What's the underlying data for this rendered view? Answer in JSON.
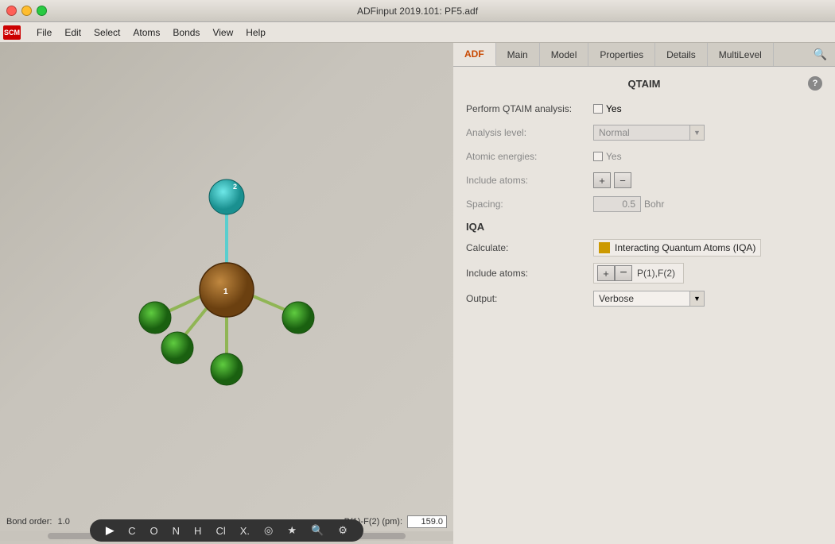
{
  "window": {
    "title": "ADFinput 2019.101: PF5.adf"
  },
  "titlebar_buttons": {
    "close": "close",
    "minimize": "minimize",
    "maximize": "maximize"
  },
  "menubar": {
    "logo": "SCM",
    "items": [
      "File",
      "Edit",
      "Select",
      "Atoms",
      "Bonds",
      "View",
      "Help"
    ]
  },
  "tabs": {
    "items": [
      "ADF",
      "Main",
      "Model",
      "Properties",
      "Details",
      "MultiLevel"
    ],
    "active": "ADF"
  },
  "section": {
    "title": "QTAIM",
    "help": "?"
  },
  "qtaim": {
    "perform_label": "Perform QTAIM analysis:",
    "perform_checked": false,
    "perform_yes": "Yes",
    "analysis_level_label": "Analysis level:",
    "analysis_level_value": "Normal",
    "atomic_energies_label": "Atomic energies:",
    "atomic_energies_checked": false,
    "atomic_energies_yes": "Yes",
    "include_atoms_label": "Include atoms:",
    "btn_plus": "+",
    "btn_minus": "−",
    "spacing_label": "Spacing:",
    "spacing_value": "0.5",
    "spacing_unit": "Bohr"
  },
  "iqa": {
    "section_title": "IQA",
    "calculate_label": "Calculate:",
    "iqa_checkbox_label": "Interacting Quantum Atoms (IQA)",
    "include_atoms_label": "Include atoms:",
    "btn_plus": "+",
    "btn_minus": "−",
    "atoms_value": "P(1),F(2)",
    "output_label": "Output:",
    "output_value": "Verbose"
  },
  "viewport": {
    "bond_order_label": "Bond order:",
    "bond_order_value": "1.0",
    "distance_label": "P(1)-F(2) (pm):",
    "distance_value": "159.0"
  },
  "toolbar": {
    "items": [
      "▶",
      "C",
      "O",
      "N",
      "H",
      "Cl",
      "X",
      "◉",
      "★",
      "🔍",
      "⚙"
    ]
  }
}
